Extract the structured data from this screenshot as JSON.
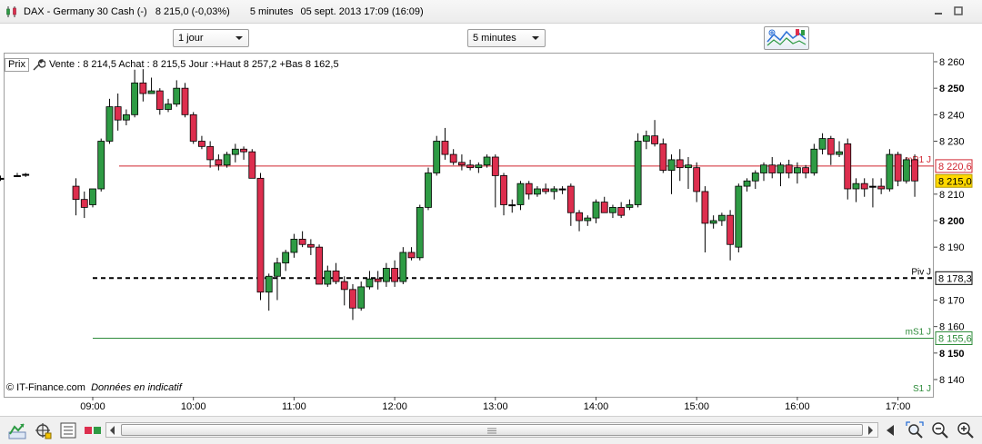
{
  "window": {
    "title": "DAX - Germany 30 Cash (-)   8 215,0 (-0,03%)",
    "timeframe": "5 minutes",
    "datetime": "05 sept. 2013 17:09 (16:09)",
    "minimize_icon": "minimize-icon",
    "maximize_icon": "maximize-icon"
  },
  "toolbar": {
    "period_select": "1 jour",
    "interval_select": "5 minutes",
    "indicators_icon": "indicators-icon"
  },
  "info": {
    "prix_label": "Prix",
    "quote": "Vente : 8 214,5 Achat : 8 215,5 Jour :+Haut 8 257,2 +Bas 8 162,5"
  },
  "source": {
    "copyright": "© IT-Finance.com",
    "note": "Données en indicatif"
  },
  "chart_data": {
    "type": "candlestick",
    "ylim": [
      8133,
      8264
    ],
    "y_ticks": [
      {
        "value": 8260,
        "label": "8 260",
        "bold": false
      },
      {
        "value": 8250,
        "label": "8 250",
        "bold": true
      },
      {
        "value": 8240,
        "label": "8 240",
        "bold": false
      },
      {
        "value": 8230,
        "label": "8 230",
        "bold": false
      },
      {
        "value": 8210,
        "label": "8 210",
        "bold": false
      },
      {
        "value": 8200,
        "label": "8 200",
        "bold": true
      },
      {
        "value": 8190,
        "label": "8 190",
        "bold": false
      },
      {
        "value": 8170,
        "label": "8 170",
        "bold": false
      },
      {
        "value": 8160,
        "label": "8 160",
        "bold": false
      },
      {
        "value": 8150,
        "label": "8 150",
        "bold": true
      },
      {
        "value": 8140,
        "label": "8 140",
        "bold": false
      }
    ],
    "x_ticks": [
      "09:00",
      "10:00",
      "11:00",
      "12:00",
      "13:00",
      "14:00",
      "15:00",
      "16:00",
      "17:00"
    ],
    "levels": [
      {
        "name": "mR1 J",
        "value": 8220.6,
        "label": "8 220,6",
        "color": "#d0242f",
        "style": "solid"
      },
      {
        "name": "Piv J",
        "value": 8178.3,
        "label": "8 178,3",
        "color": "#000000",
        "style": "dashed"
      },
      {
        "name": "mS1 J",
        "value": 8155.6,
        "label": "8 155,6",
        "color": "#2e8b3a",
        "style": "solid"
      },
      {
        "name": "S1 J",
        "value": 8130,
        "label": "",
        "color": "#2e8b3a",
        "style": "solid"
      }
    ],
    "last_price": {
      "value": 8215.0,
      "label": "8 215,0",
      "bg": "#ffd800"
    },
    "colors": {
      "up": "#2e9b44",
      "down": "#dd2e4e",
      "flat": "#000000"
    },
    "candles": [
      {
        "t": "07:40",
        "o": 8217.0,
        "h": 8218.0,
        "l": 8216.0,
        "c": 8217.0
      },
      {
        "t": "07:45",
        "o": 8217.0,
        "h": 8218.0,
        "l": 8216.0,
        "c": 8217.0
      },
      {
        "t": "07:50",
        "o": 8217.0,
        "h": 8217.5,
        "l": 8216.0,
        "c": 8217.0
      },
      {
        "t": "08:00",
        "o": 8216.0,
        "h": 8217.0,
        "l": 8215.0,
        "c": 8216.0
      },
      {
        "t": "08:05",
        "o": 8216.0,
        "h": 8217.0,
        "l": 8215.0,
        "c": 8216.0
      },
      {
        "t": "08:15",
        "o": 8217.0,
        "h": 8218.0,
        "l": 8216.5,
        "c": 8217.0
      },
      {
        "t": "08:20",
        "o": 8217.5,
        "h": 8218.0,
        "l": 8216.5,
        "c": 8217.5
      },
      {
        "t": "08:50",
        "o": 8213.0,
        "h": 8216.0,
        "l": 8202.0,
        "c": 8208.0
      },
      {
        "t": "08:55",
        "o": 8208.0,
        "h": 8211.0,
        "l": 8201.0,
        "c": 8205.0
      },
      {
        "t": "09:00",
        "o": 8206.0,
        "h": 8212.0,
        "l": 8205.0,
        "c": 8212.0
      },
      {
        "t": "09:05",
        "o": 8212.0,
        "h": 8231.0,
        "l": 8211.0,
        "c": 8230.0
      },
      {
        "t": "09:10",
        "o": 8230.0,
        "h": 8246.0,
        "l": 8229.0,
        "c": 8243.0
      },
      {
        "t": "09:15",
        "o": 8243.0,
        "h": 8248.0,
        "l": 8234.0,
        "c": 8238.0
      },
      {
        "t": "09:20",
        "o": 8238.0,
        "h": 8242.0,
        "l": 8236.0,
        "c": 8240.0
      },
      {
        "t": "09:25",
        "o": 8240.0,
        "h": 8257.0,
        "l": 8239.0,
        "c": 8252.0
      },
      {
        "t": "09:30",
        "o": 8252.0,
        "h": 8257.2,
        "l": 8245.0,
        "c": 8248.0
      },
      {
        "t": "09:35",
        "o": 8248.0,
        "h": 8254.0,
        "l": 8248.0,
        "c": 8249.0
      },
      {
        "t": "09:40",
        "o": 8249.0,
        "h": 8250.0,
        "l": 8240.0,
        "c": 8242.0
      },
      {
        "t": "09:45",
        "o": 8242.0,
        "h": 8246.0,
        "l": 8241.0,
        "c": 8244.0
      },
      {
        "t": "09:50",
        "o": 8244.0,
        "h": 8253.0,
        "l": 8243.0,
        "c": 8250.0
      },
      {
        "t": "09:55",
        "o": 8250.0,
        "h": 8252.0,
        "l": 8239.0,
        "c": 8240.0
      },
      {
        "t": "10:00",
        "o": 8240.0,
        "h": 8241.0,
        "l": 8229.0,
        "c": 8230.0
      },
      {
        "t": "10:05",
        "o": 8230.0,
        "h": 8232.0,
        "l": 8227.0,
        "c": 8228.0
      },
      {
        "t": "10:10",
        "o": 8228.0,
        "h": 8230.0,
        "l": 8220.0,
        "c": 8223.0
      },
      {
        "t": "10:15",
        "o": 8223.0,
        "h": 8225.0,
        "l": 8219.0,
        "c": 8221.0
      },
      {
        "t": "10:20",
        "o": 8221.0,
        "h": 8226.0,
        "l": 8220.0,
        "c": 8225.0
      },
      {
        "t": "10:25",
        "o": 8225.0,
        "h": 8229.0,
        "l": 8222.0,
        "c": 8227.0
      },
      {
        "t": "10:30",
        "o": 8227.0,
        "h": 8228.0,
        "l": 8223.0,
        "c": 8226.0
      },
      {
        "t": "10:35",
        "o": 8226.0,
        "h": 8227.0,
        "l": 8218.0,
        "c": 8216.0
      },
      {
        "t": "10:40",
        "o": 8216.0,
        "h": 8218.0,
        "l": 8170.0,
        "c": 8173.0
      },
      {
        "t": "10:45",
        "o": 8173.0,
        "h": 8180.0,
        "l": 8166.0,
        "c": 8179.0
      },
      {
        "t": "10:50",
        "o": 8179.0,
        "h": 8186.0,
        "l": 8170.0,
        "c": 8184.0
      },
      {
        "t": "10:55",
        "o": 8184.0,
        "h": 8189.0,
        "l": 8181.0,
        "c": 8188.0
      },
      {
        "t": "11:00",
        "o": 8188.0,
        "h": 8195.0,
        "l": 8186.0,
        "c": 8193.0
      },
      {
        "t": "11:05",
        "o": 8193.0,
        "h": 8196.0,
        "l": 8190.0,
        "c": 8191.0
      },
      {
        "t": "11:10",
        "o": 8191.0,
        "h": 8193.0,
        "l": 8187.0,
        "c": 8190.0
      },
      {
        "t": "11:15",
        "o": 8190.0,
        "h": 8191.0,
        "l": 8182.0,
        "c": 8176.0
      },
      {
        "t": "11:20",
        "o": 8176.0,
        "h": 8183.0,
        "l": 8175.0,
        "c": 8181.0
      },
      {
        "t": "11:25",
        "o": 8181.0,
        "h": 8184.0,
        "l": 8176.0,
        "c": 8177.0
      },
      {
        "t": "11:30",
        "o": 8177.0,
        "h": 8179.0,
        "l": 8168.0,
        "c": 8174.0
      },
      {
        "t": "11:35",
        "o": 8174.0,
        "h": 8176.0,
        "l": 8162.5,
        "c": 8167.0
      },
      {
        "t": "11:40",
        "o": 8167.0,
        "h": 8177.0,
        "l": 8166.0,
        "c": 8175.0
      },
      {
        "t": "11:45",
        "o": 8175.0,
        "h": 8181.0,
        "l": 8174.0,
        "c": 8178.0
      },
      {
        "t": "11:50",
        "o": 8178.0,
        "h": 8181.0,
        "l": 8174.0,
        "c": 8177.0
      },
      {
        "t": "11:55",
        "o": 8177.0,
        "h": 8184.0,
        "l": 8175.0,
        "c": 8182.0
      },
      {
        "t": "12:00",
        "o": 8182.0,
        "h": 8185.0,
        "l": 8175.0,
        "c": 8177.0
      },
      {
        "t": "12:05",
        "o": 8177.0,
        "h": 8190.0,
        "l": 8176.0,
        "c": 8188.0
      },
      {
        "t": "12:10",
        "o": 8188.0,
        "h": 8190.0,
        "l": 8185.0,
        "c": 8186.0
      },
      {
        "t": "12:15",
        "o": 8186.0,
        "h": 8206.0,
        "l": 8185.0,
        "c": 8205.0
      },
      {
        "t": "12:20",
        "o": 8205.0,
        "h": 8220.0,
        "l": 8204.0,
        "c": 8218.0
      },
      {
        "t": "12:25",
        "o": 8218.0,
        "h": 8232.0,
        "l": 8217.0,
        "c": 8230.0
      },
      {
        "t": "12:30",
        "o": 8230.0,
        "h": 8235.0,
        "l": 8223.0,
        "c": 8225.0
      },
      {
        "t": "12:35",
        "o": 8225.0,
        "h": 8227.0,
        "l": 8221.0,
        "c": 8222.0
      },
      {
        "t": "12:40",
        "o": 8222.0,
        "h": 8225.0,
        "l": 8219.0,
        "c": 8221.0
      },
      {
        "t": "12:45",
        "o": 8221.0,
        "h": 8223.0,
        "l": 8219.0,
        "c": 8220.0
      },
      {
        "t": "12:50",
        "o": 8220.0,
        "h": 8222.0,
        "l": 8218.0,
        "c": 8221.0
      },
      {
        "t": "12:55",
        "o": 8221.0,
        "h": 8225.0,
        "l": 8220.0,
        "c": 8224.0
      },
      {
        "t": "13:00",
        "o": 8224.0,
        "h": 8225.0,
        "l": 8205.0,
        "c": 8217.0
      },
      {
        "t": "13:05",
        "o": 8217.0,
        "h": 8218.0,
        "l": 8202.0,
        "c": 8206.0
      },
      {
        "t": "13:10",
        "o": 8206.0,
        "h": 8208.0,
        "l": 8203.0,
        "c": 8206.0
      },
      {
        "t": "13:15",
        "o": 8206.0,
        "h": 8215.0,
        "l": 8204.0,
        "c": 8214.0
      },
      {
        "t": "13:20",
        "o": 8214.0,
        "h": 8215.0,
        "l": 8208.0,
        "c": 8210.0
      },
      {
        "t": "13:25",
        "o": 8210.0,
        "h": 8213.0,
        "l": 8209.0,
        "c": 8212.0
      },
      {
        "t": "13:30",
        "o": 8212.0,
        "h": 8214.0,
        "l": 8210.0,
        "c": 8211.0
      },
      {
        "t": "13:35",
        "o": 8211.0,
        "h": 8213.0,
        "l": 8208.0,
        "c": 8212.0
      },
      {
        "t": "13:40",
        "o": 8212.0,
        "h": 8213.0,
        "l": 8210.0,
        "c": 8212.0
      },
      {
        "t": "13:45",
        "o": 8213.0,
        "h": 8214.0,
        "l": 8198.0,
        "c": 8203.0
      },
      {
        "t": "13:50",
        "o": 8203.0,
        "h": 8204.0,
        "l": 8196.0,
        "c": 8200.0
      },
      {
        "t": "13:55",
        "o": 8200.0,
        "h": 8202.0,
        "l": 8198.0,
        "c": 8201.0
      },
      {
        "t": "14:00",
        "o": 8201.0,
        "h": 8208.0,
        "l": 8199.0,
        "c": 8207.0
      },
      {
        "t": "14:05",
        "o": 8207.0,
        "h": 8209.0,
        "l": 8203.0,
        "c": 8203.0
      },
      {
        "t": "14:10",
        "o": 8203.0,
        "h": 8206.0,
        "l": 8201.0,
        "c": 8205.0
      },
      {
        "t": "14:15",
        "o": 8205.0,
        "h": 8207.0,
        "l": 8201.0,
        "c": 8202.0
      },
      {
        "t": "14:20",
        "o": 8205.0,
        "h": 8208.0,
        "l": 8204.0,
        "c": 8206.0
      },
      {
        "t": "14:25",
        "o": 8206.0,
        "h": 8233.0,
        "l": 8205.0,
        "c": 8230.0
      },
      {
        "t": "14:30",
        "o": 8230.0,
        "h": 8234.0,
        "l": 8227.0,
        "c": 8232.0
      },
      {
        "t": "14:35",
        "o": 8232.0,
        "h": 8238.0,
        "l": 8228.0,
        "c": 8229.0
      },
      {
        "t": "14:40",
        "o": 8229.0,
        "h": 8231.0,
        "l": 8218.0,
        "c": 8219.0
      },
      {
        "t": "14:45",
        "o": 8219.0,
        "h": 8225.0,
        "l": 8210.0,
        "c": 8223.0
      },
      {
        "t": "14:50",
        "o": 8223.0,
        "h": 8227.0,
        "l": 8215.0,
        "c": 8220.0
      },
      {
        "t": "14:55",
        "o": 8220.0,
        "h": 8224.0,
        "l": 8212.0,
        "c": 8221.0
      },
      {
        "t": "15:00",
        "o": 8220.0,
        "h": 8222.0,
        "l": 8207.0,
        "c": 8211.0
      },
      {
        "t": "15:05",
        "o": 8211.0,
        "h": 8213.0,
        "l": 8188.0,
        "c": 8199.0
      },
      {
        "t": "15:10",
        "o": 8199.0,
        "h": 8202.0,
        "l": 8197.0,
        "c": 8200.0
      },
      {
        "t": "15:15",
        "o": 8200.0,
        "h": 8203.0,
        "l": 8198.0,
        "c": 8202.0
      },
      {
        "t": "15:20",
        "o": 8202.0,
        "h": 8204.0,
        "l": 8185.0,
        "c": 8191.0
      },
      {
        "t": "15:25",
        "o": 8190.0,
        "h": 8214.0,
        "l": 8188.0,
        "c": 8213.0
      },
      {
        "t": "15:30",
        "o": 8213.0,
        "h": 8216.0,
        "l": 8211.0,
        "c": 8215.0
      },
      {
        "t": "15:35",
        "o": 8215.0,
        "h": 8219.0,
        "l": 8212.0,
        "c": 8218.0
      },
      {
        "t": "15:40",
        "o": 8218.0,
        "h": 8222.0,
        "l": 8215.0,
        "c": 8221.0
      },
      {
        "t": "15:45",
        "o": 8221.0,
        "h": 8224.0,
        "l": 8216.0,
        "c": 8218.0
      },
      {
        "t": "15:50",
        "o": 8218.0,
        "h": 8222.0,
        "l": 8213.0,
        "c": 8221.0
      },
      {
        "t": "15:55",
        "o": 8221.0,
        "h": 8223.0,
        "l": 8216.0,
        "c": 8218.0
      },
      {
        "t": "16:00",
        "o": 8218.0,
        "h": 8222.0,
        "l": 8214.0,
        "c": 8220.0
      },
      {
        "t": "16:05",
        "o": 8220.0,
        "h": 8221.0,
        "l": 8216.0,
        "c": 8218.0
      },
      {
        "t": "16:10",
        "o": 8218.0,
        "h": 8229.0,
        "l": 8217.0,
        "c": 8227.0
      },
      {
        "t": "16:15",
        "o": 8227.0,
        "h": 8233.0,
        "l": 8225.0,
        "c": 8231.0
      },
      {
        "t": "16:20",
        "o": 8231.0,
        "h": 8232.0,
        "l": 8221.0,
        "c": 8225.0
      },
      {
        "t": "16:25",
        "o": 8225.0,
        "h": 8230.0,
        "l": 8224.0,
        "c": 8226.0
      },
      {
        "t": "16:30",
        "o": 8229.0,
        "h": 8231.0,
        "l": 8208.0,
        "c": 8212.0
      },
      {
        "t": "16:35",
        "o": 8212.0,
        "h": 8216.0,
        "l": 8207.0,
        "c": 8214.0
      },
      {
        "t": "16:40",
        "o": 8214.0,
        "h": 8216.0,
        "l": 8209.0,
        "c": 8212.0
      },
      {
        "t": "16:45",
        "o": 8213.0,
        "h": 8216.0,
        "l": 8205.0,
        "c": 8213.0
      },
      {
        "t": "16:50",
        "o": 8213.0,
        "h": 8216.0,
        "l": 8210.0,
        "c": 8212.0
      },
      {
        "t": "16:55",
        "o": 8212.0,
        "h": 8227.0,
        "l": 8211.0,
        "c": 8225.0
      },
      {
        "t": "17:00",
        "o": 8225.0,
        "h": 8226.0,
        "l": 8213.0,
        "c": 8215.0
      },
      {
        "t": "17:05",
        "o": 8215.0,
        "h": 8224.0,
        "l": 8214.0,
        "c": 8223.0
      },
      {
        "t": "17:10",
        "o": 8223.0,
        "h": 8225.0,
        "l": 8209.0,
        "c": 8215.0
      }
    ]
  },
  "bottom_icons": [
    "chart-type-icon",
    "drawing-tools-icon",
    "trading-icon",
    "compare-icon",
    "zoom-fit-icon",
    "zoom-out-icon",
    "zoom-in-icon"
  ]
}
